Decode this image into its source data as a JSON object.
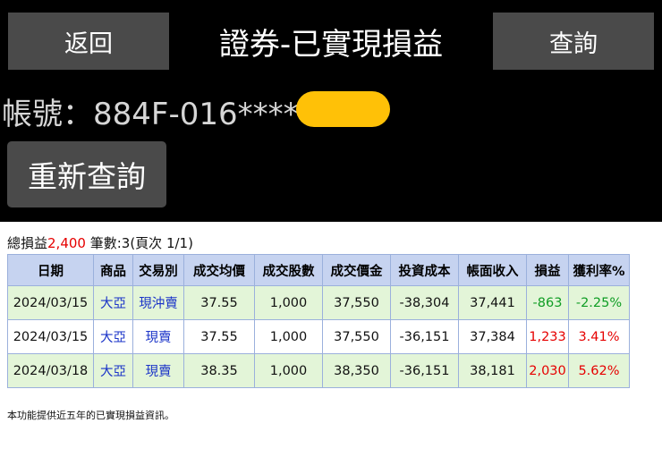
{
  "header": {
    "back_label": "返回",
    "title": "證券-已實現損益",
    "query_label": "查詢",
    "account_text": "帳號：884F-016****",
    "requery_label": "重新查詢"
  },
  "summary": {
    "total_label": "總損益",
    "total_value": "2,400",
    "rest": " 筆數:3(頁次 1/1)"
  },
  "table": {
    "headers": [
      "日期",
      "商品",
      "交易別",
      "成交均價",
      "成交股數",
      "成交價金",
      "投資成本",
      "帳面收入",
      "損益",
      "獲利率%"
    ],
    "rows": [
      {
        "date": "2024/03/15",
        "stock": "大亞",
        "trade": "現沖賣",
        "avg_price": "37.55",
        "shares": "1,000",
        "amount": "37,550",
        "cost": "-38,304",
        "income": "37,441",
        "pnl": "-863",
        "rate": "-2.25%"
      },
      {
        "date": "2024/03/15",
        "stock": "大亞",
        "trade": "現賣",
        "avg_price": "37.55",
        "shares": "1,000",
        "amount": "37,550",
        "cost": "-36,151",
        "income": "37,384",
        "pnl": "1,233",
        "rate": "3.41%"
      },
      {
        "date": "2024/03/18",
        "stock": "大亞",
        "trade": "現賣",
        "avg_price": "38.35",
        "shares": "1,000",
        "amount": "38,350",
        "cost": "-36,151",
        "income": "38,181",
        "pnl": "2,030",
        "rate": "5.62%"
      }
    ]
  },
  "footer_note": "本功能提供近五年的已實現損益資訊。",
  "colors": {
    "header_bg": "#000000",
    "button_bg": "#4a4a4a",
    "redaction": "#ffc107",
    "table_header": "#c6d3f0",
    "row_alt": "#e3f5d8",
    "positive": "#e60000",
    "negative": "#0f9d24",
    "link": "#1a33c8"
  }
}
